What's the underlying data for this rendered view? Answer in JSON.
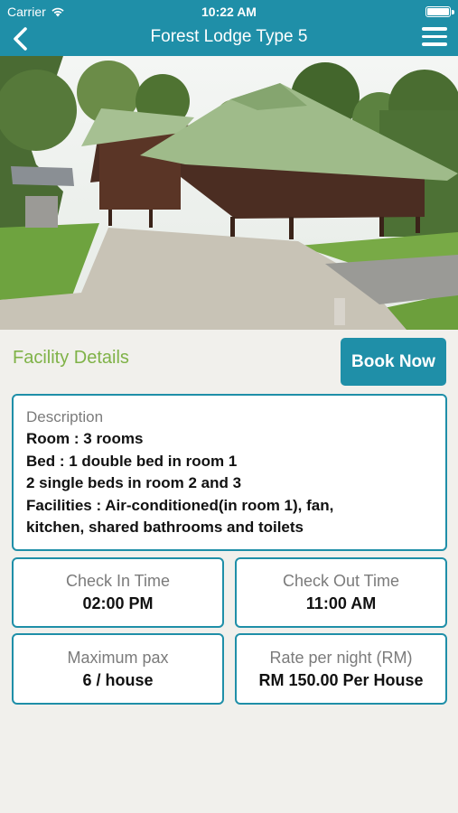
{
  "status_bar": {
    "carrier": "Carrier",
    "time": "10:22 AM"
  },
  "nav": {
    "title": "Forest Lodge Type 5",
    "back_icon": "chevron-left-icon",
    "menu_icon": "hamburger-menu-icon"
  },
  "facility": {
    "heading": "Facility Details",
    "book_button": "Book Now"
  },
  "description": {
    "label": "Description",
    "lines": [
      "Room : 3 rooms",
      "Bed : 1 double bed in room 1",
      "2 single beds in room 2 and 3",
      "Facilities : Air-conditioned(in room 1), fan,",
      "kitchen, shared bathrooms and toilets"
    ]
  },
  "info_cards": [
    {
      "label": "Check In Time",
      "value": "02:00 PM"
    },
    {
      "label": "Check Out Time",
      "value": "11:00 AM"
    },
    {
      "label": "Maximum pax",
      "value": "6 / house"
    },
    {
      "label": "Rate per night (RM)",
      "value": "RM 150.00 Per House"
    }
  ],
  "colors": {
    "primary": "#1f8fa8",
    "accent_green": "#7fb247",
    "background": "#f1f0ec"
  }
}
